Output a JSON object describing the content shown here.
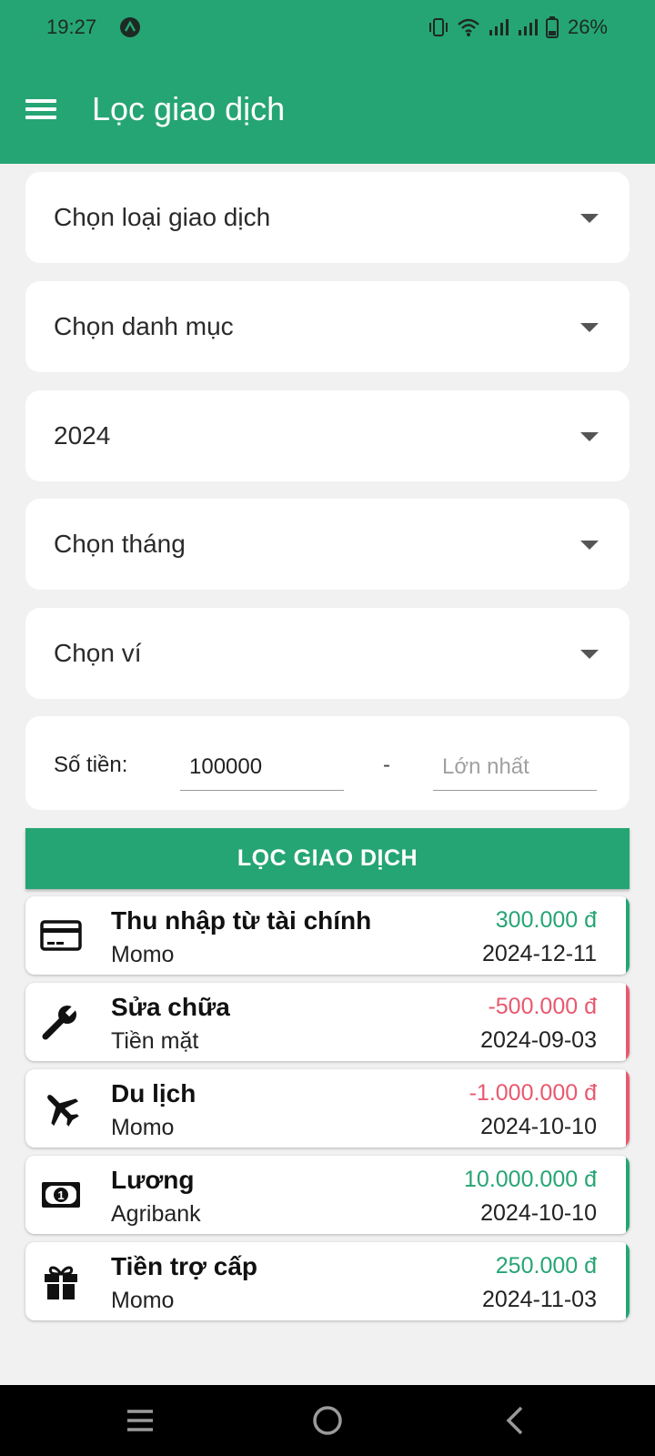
{
  "status_bar": {
    "time": "19:27",
    "battery": "26%"
  },
  "header": {
    "title": "Lọc giao dịch"
  },
  "filters": {
    "dropdowns": [
      {
        "label": "Chọn loại giao dịch"
      },
      {
        "label": "Chọn danh mục"
      },
      {
        "label": "2024"
      },
      {
        "label": "Chọn tháng"
      },
      {
        "label": "Chọn ví"
      }
    ],
    "amount": {
      "label": "Số tiền:",
      "min_value": "100000",
      "separator": "-",
      "max_placeholder": "Lớn nhất"
    },
    "submit_label": "LỌC GIAO DỊCH"
  },
  "transactions": [
    {
      "name": "Thu nhập từ tài chính",
      "wallet": "Momo",
      "amount": "300.000 đ",
      "date": "2024-12-11",
      "icon": "credit-card-icon",
      "type": "income"
    },
    {
      "name": "Sửa chữa",
      "wallet": "Tiền mặt",
      "amount": "-500.000 đ",
      "date": "2024-09-03",
      "icon": "wrench-icon",
      "type": "expense"
    },
    {
      "name": "Du lịch",
      "wallet": "Momo",
      "amount": "-1.000.000 đ",
      "date": "2024-10-10",
      "icon": "airplane-icon",
      "type": "expense"
    },
    {
      "name": "Lương",
      "wallet": "Agribank",
      "amount": "10.000.000 đ",
      "date": "2024-10-10",
      "icon": "money-bill-icon",
      "type": "income"
    },
    {
      "name": "Tiền trợ cấp",
      "wallet": "Momo",
      "amount": "250.000 đ",
      "date": "2024-11-03",
      "icon": "gift-icon",
      "type": "income"
    }
  ],
  "colors": {
    "primary": "#26a574",
    "income": "#26a574",
    "expense": "#e8596e",
    "background": "#f1f1f1"
  }
}
